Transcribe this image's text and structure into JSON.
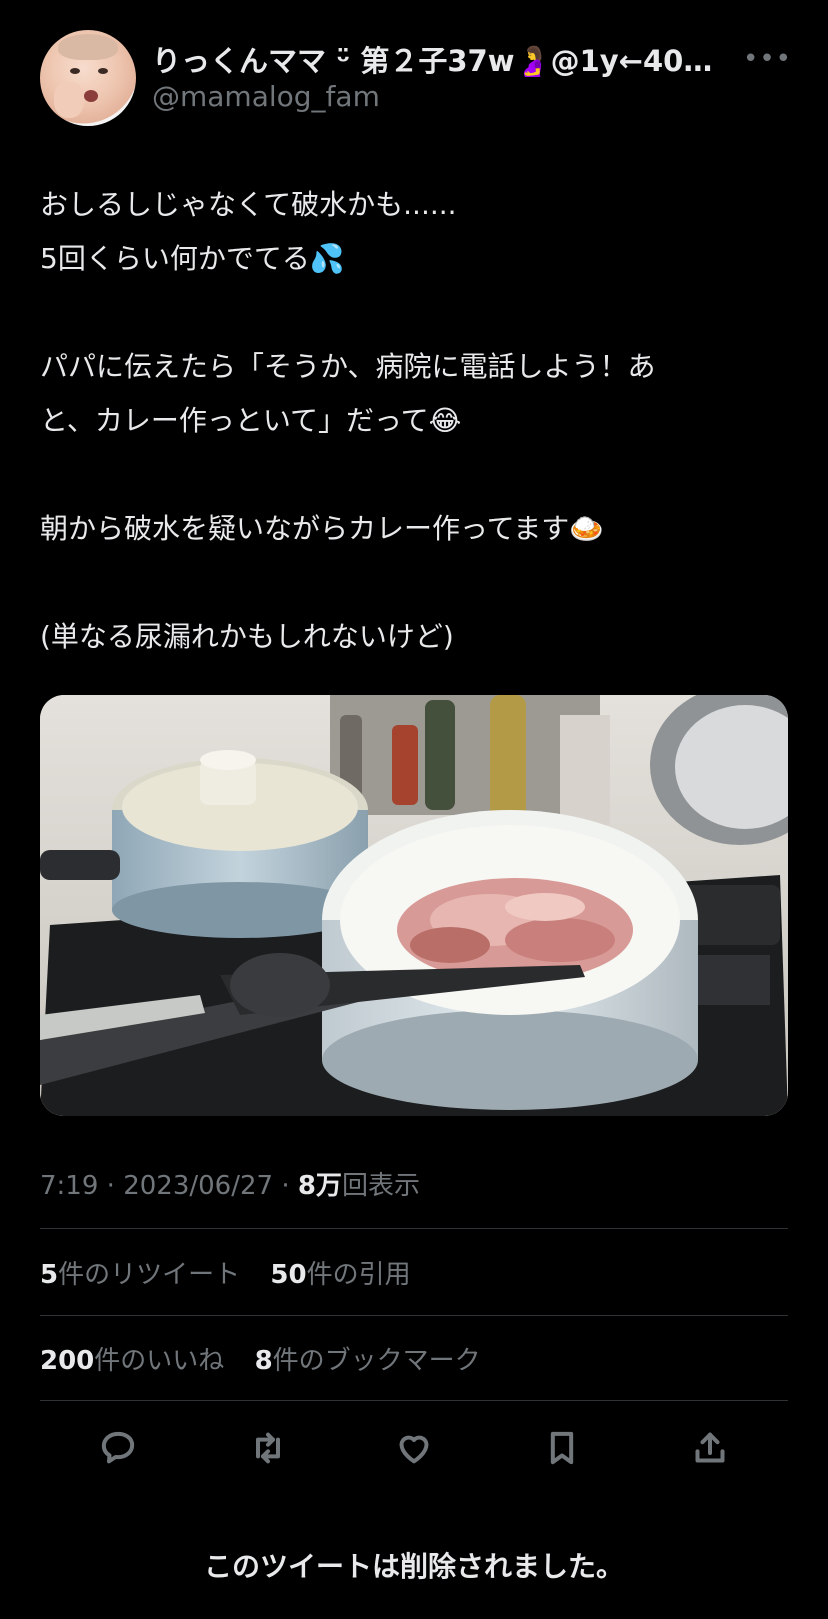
{
  "tweet": {
    "display_name": "りっくんママ ᵕ̈ 第２子37w🤰@1y←40…",
    "handle": "@mamalog_fam",
    "text_lines": [
      "おしるしじゃなくて破水かも......",
      "5回くらい何かでてる💦",
      "",
      "パパに伝えたら「そうか、病院に電話しよう！あ",
      "と、カレー作っといて」だって😂",
      "",
      "朝から破水を疑いながらカレー作ってます🍛",
      "",
      "(単なる尿漏れかもしれないけど)"
    ],
    "time": "7:19",
    "date": "2023/06/27",
    "views_count": "8万",
    "views_label": "回表示"
  },
  "stats": {
    "retweets_count": "5",
    "retweets_label": "件のリツイート",
    "quotes_count": "50",
    "quotes_label": "件の引用",
    "likes_count": "200",
    "likes_label": "件のいいね",
    "bookmarks_count": "8",
    "bookmarks_label": "件のブックマーク"
  },
  "actions": [
    {
      "icon": "reply-icon"
    },
    {
      "icon": "retweet-icon"
    },
    {
      "icon": "like-icon"
    },
    {
      "icon": "bookmark-icon"
    },
    {
      "icon": "share-icon"
    }
  ],
  "footer": {
    "deleted_notice": "このツイートは削除されました。"
  },
  "colors": {
    "background": "#000000",
    "text_primary": "#e7e9ea",
    "text_secondary": "#71767b",
    "divider": "#2f3336"
  }
}
